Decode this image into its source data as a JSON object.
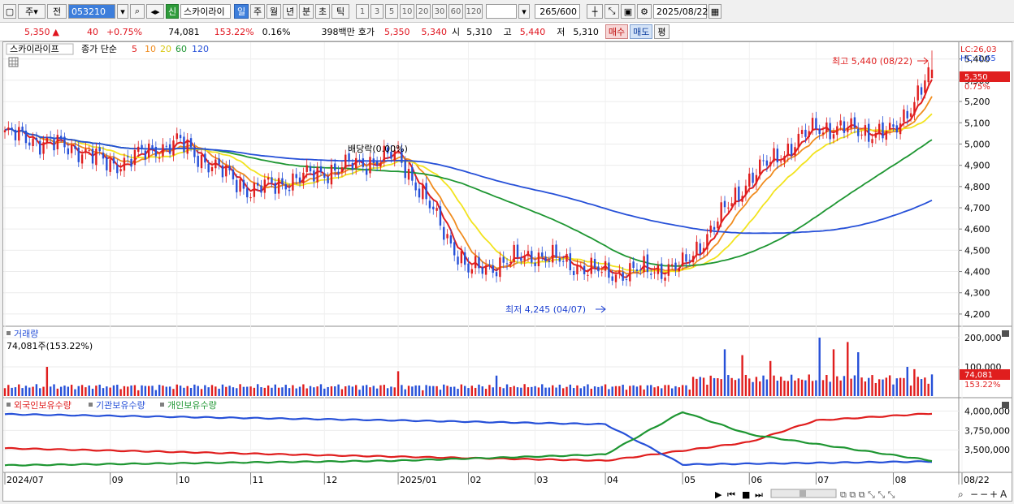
{
  "toolbar": {
    "type_select": "주",
    "prev_label": "전",
    "code": "053210",
    "market_badge": "신",
    "stock_name": "스카이라이",
    "period_tabs": [
      "일",
      "주",
      "월",
      "년",
      "분",
      "초",
      "틱"
    ],
    "active_period": "일",
    "interval_buttons": [
      "1",
      "3",
      "5",
      "10",
      "20",
      "30",
      "60",
      "120"
    ],
    "count": "265",
    "count_total": "/600",
    "date": "2025/08/22",
    "icons": [
      "search-icon",
      "sound-icon",
      "candle-icon",
      "draw-icon",
      "save-icon",
      "gear-icon"
    ]
  },
  "quote": {
    "price": "5,350",
    "change_arrow": "▲",
    "change": "40",
    "change_pct": "+0.75%",
    "volume": "74,081",
    "volume_ratio": "153.22%",
    "turnover": "0.16%",
    "amount": "398백만",
    "bid_label": "호가",
    "ask_price": "5,350",
    "bid_price": "5,340",
    "open_label": "시",
    "open": "5,310",
    "high_label": "고",
    "high": "5,440",
    "low_label": "저",
    "low": "5,310",
    "buy_button": "매수",
    "sell_button": "매도",
    "eval_button": "평"
  },
  "chart_data": {
    "type": "candlestick",
    "title": "스카이라이프",
    "ma_label": "종가 단순",
    "ma_periods": [
      "5",
      "10",
      "20",
      "60",
      "120"
    ],
    "ma_colors": [
      "#e01e1e",
      "#f08c1e",
      "#f2e31e",
      "#1e9632",
      "#2650d8"
    ],
    "price_ylim": [
      4150,
      5460
    ],
    "price_ticks": [
      "5,400",
      "5,300",
      "5,200",
      "5,100",
      "5,000",
      "4,900",
      "4,800",
      "4,700",
      "4,600",
      "4,500",
      "4,400",
      "4,300",
      "4,200"
    ],
    "right_labels": {
      "lc": "LC:26,03",
      "hc": "HC:-1,65",
      "last_price": "5,350",
      "last_change": "0.75%"
    },
    "annotations": {
      "high": "최고 5,440 (08/22)",
      "low": "최저 4,245 (04/07)",
      "dividend": "배당락(0.00%)"
    },
    "x_labels": [
      "2024/07",
      "09",
      "10",
      "11",
      "12",
      "2025/01",
      "02",
      "03",
      "04",
      "05",
      "06",
      "07",
      "08",
      "08/22"
    ],
    "ohlc_anchors": [
      {
        "date": "2024/07",
        "close": 5050
      },
      {
        "date": "2024/08",
        "close": 4970
      },
      {
        "date": "2024/09",
        "close": 4900
      },
      {
        "date": "2024/10",
        "close": 5010
      },
      {
        "date": "2024/11",
        "close": 4780
      },
      {
        "date": "2024/12",
        "close": 4870
      },
      {
        "date": "2025/01",
        "close": 4950
      },
      {
        "date": "2025/02",
        "close": 4400
      },
      {
        "date": "2025/03",
        "close": 4480
      },
      {
        "date": "2025/04",
        "close": 4390
      },
      {
        "date": "2025/05",
        "close": 4420
      },
      {
        "date": "2025/06",
        "close": 4840
      },
      {
        "date": "2025/07",
        "close": 5080
      },
      {
        "date": "2025/08",
        "close": 5050
      },
      {
        "date": "2025/08/22",
        "open": 5310,
        "high": 5440,
        "low": 5310,
        "close": 5350
      }
    ],
    "volume": {
      "title": "거래량",
      "last_label": "74,081주(153.22%)",
      "ylim": [
        0,
        225000
      ],
      "ticks": [
        "200,000",
        "100,000"
      ],
      "last_value": "74,081",
      "last_ratio": "153.22%"
    },
    "holdings": {
      "series": [
        "외국인보유수량",
        "기관보유수량",
        "개인보유수량"
      ],
      "colors": [
        "#e01e1e",
        "#2650d8",
        "#1e9632"
      ],
      "ylim": [
        3230000,
        4100000
      ],
      "ticks": [
        "4,000,000",
        "3,750,000",
        "3,500,000"
      ],
      "foreign": [
        {
          "date": "2024/07",
          "value": 3520000
        },
        {
          "date": "2024/12",
          "value": 3430000
        },
        {
          "date": "2025/04",
          "value": 3360000
        },
        {
          "date": "2025/06",
          "value": 3600000
        },
        {
          "date": "2025/07",
          "value": 3880000
        },
        {
          "date": "2025/08/22",
          "value": 3970000
        }
      ],
      "institution": [
        {
          "date": "2024/07",
          "value": 3960000
        },
        {
          "date": "2025/01",
          "value": 3880000
        },
        {
          "date": "2025/04",
          "value": 3830000
        },
        {
          "date": "2025/05",
          "value": 3310000
        },
        {
          "date": "2025/08/22",
          "value": 3350000
        }
      ],
      "individual": [
        {
          "date": "2024/07",
          "value": 3300000
        },
        {
          "date": "2025/01",
          "value": 3360000
        },
        {
          "date": "2025/04",
          "value": 3440000
        },
        {
          "date": "2025/05",
          "value": 3990000
        },
        {
          "date": "2025/06",
          "value": 3700000
        },
        {
          "date": "2025/08/22",
          "value": 3360000
        }
      ]
    }
  }
}
